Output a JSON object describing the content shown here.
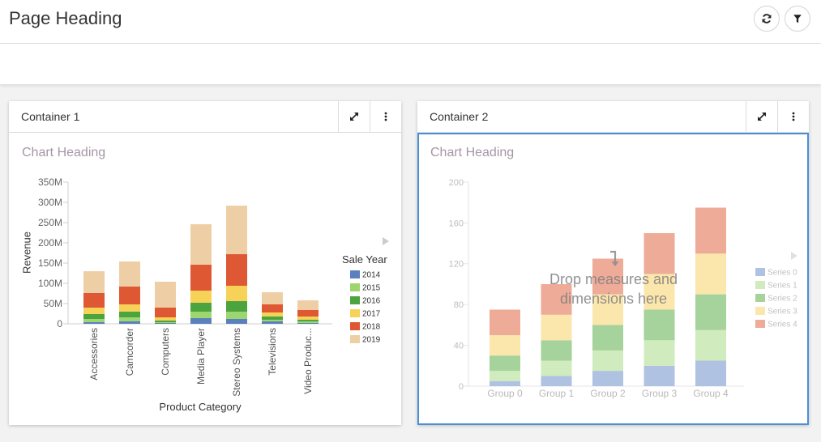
{
  "page": {
    "title": "Page Heading",
    "toolbar": [
      {
        "name": "refresh",
        "icon": "refresh-icon"
      },
      {
        "name": "filter",
        "icon": "filter-icon"
      }
    ]
  },
  "containers": [
    {
      "title": "Container 1",
      "chart_heading": "Chart Heading",
      "actions": [
        "expand-icon",
        "more-vertical-icon"
      ],
      "selected": false
    },
    {
      "title": "Container 2",
      "chart_heading": "Chart Heading",
      "actions": [
        "expand-icon",
        "more-vertical-icon"
      ],
      "selected": true,
      "drop_hint": [
        "Drop measures and",
        "dimensions here"
      ]
    }
  ],
  "colors": {
    "accent": "#4a90d9"
  },
  "chart_data": [
    {
      "type": "bar",
      "stacked": true,
      "title": "Chart Heading",
      "xlabel": "Product Category",
      "ylabel": "Revenue",
      "value_unit": "millions",
      "categories": [
        "Accessories",
        "Camcorder",
        "Computers",
        "Media Player",
        "Stereo Systems",
        "Televisions",
        "Video Produc..."
      ],
      "ylim": [
        0,
        350
      ],
      "yticks": [
        0,
        50,
        100,
        150,
        200,
        250,
        300,
        350
      ],
      "ytick_labels": [
        "0",
        "50M",
        "100M",
        "150M",
        "200M",
        "250M",
        "300M",
        "350M"
      ],
      "grid": false,
      "legend": {
        "title": "Sale Year",
        "position": "right"
      },
      "series": [
        {
          "name": "2014",
          "color": "#5b80be",
          "values": [
            4,
            6,
            2,
            14,
            12,
            6,
            2
          ]
        },
        {
          "name": "2015",
          "color": "#9dd670",
          "values": [
            8,
            10,
            2,
            16,
            18,
            4,
            4
          ]
        },
        {
          "name": "2016",
          "color": "#4ca43e",
          "values": [
            12,
            14,
            4,
            22,
            26,
            8,
            4
          ]
        },
        {
          "name": "2017",
          "color": "#f6d258",
          "values": [
            16,
            18,
            8,
            30,
            38,
            10,
            8
          ]
        },
        {
          "name": "2018",
          "color": "#df5834",
          "values": [
            36,
            44,
            24,
            64,
            78,
            20,
            16
          ]
        },
        {
          "name": "2019",
          "color": "#eecfa5",
          "values": [
            54,
            62,
            64,
            100,
            120,
            30,
            24
          ]
        }
      ]
    },
    {
      "type": "bar",
      "stacked": true,
      "title": "Chart Heading",
      "xlabel": "",
      "ylabel": "",
      "categories": [
        "Group 0",
        "Group 1",
        "Group 2",
        "Group 3",
        "Group 4"
      ],
      "ylim": [
        0,
        200
      ],
      "yticks": [
        0,
        40,
        80,
        120,
        160,
        200
      ],
      "ytick_labels": [
        "0",
        "40",
        "80",
        "120",
        "160",
        "200"
      ],
      "grid": false,
      "legend": {
        "title": "",
        "position": "right"
      },
      "placeholder": true,
      "series": [
        {
          "name": "Series 0",
          "color": "#b0c2e1",
          "values": [
            5,
            10,
            15,
            20,
            25
          ]
        },
        {
          "name": "Series 1",
          "color": "#d0ebbd",
          "values": [
            10,
            15,
            20,
            25,
            30
          ]
        },
        {
          "name": "Series 2",
          "color": "#a6d29b",
          "values": [
            15,
            20,
            25,
            30,
            35
          ]
        },
        {
          "name": "Series 3",
          "color": "#fbe6ac",
          "values": [
            20,
            25,
            30,
            35,
            40
          ]
        },
        {
          "name": "Series 4",
          "color": "#eeab98",
          "values": [
            25,
            30,
            35,
            40,
            45
          ]
        }
      ]
    }
  ]
}
